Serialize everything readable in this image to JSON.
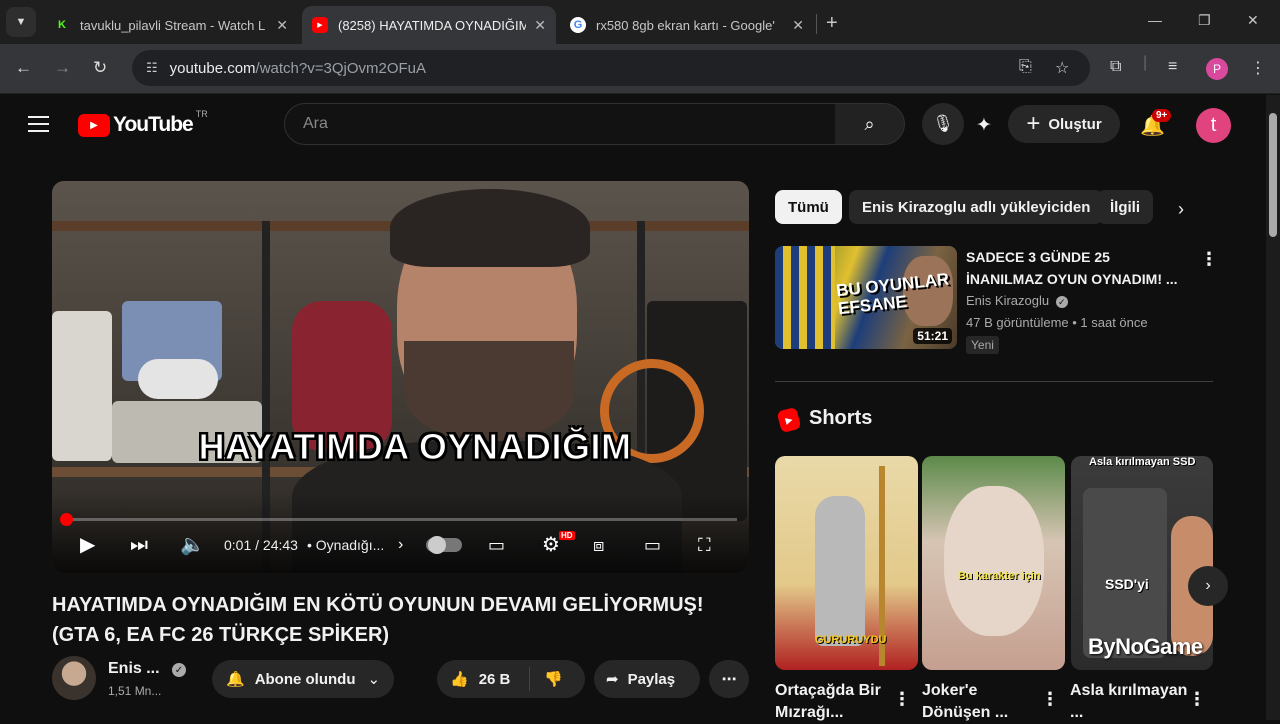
{
  "browser": {
    "tabs": [
      {
        "title": "tavuklu_pilavli Stream - Watch L",
        "favicon": "K",
        "favicon_color": "#53fc18",
        "active": false
      },
      {
        "title": "(8258) HAYATIMDA OYNADIĞIM",
        "favicon": "▶",
        "favicon_color": "#ff0000",
        "active": true
      },
      {
        "title": "rx580 8gb ekran kartı - Google'",
        "favicon": "G",
        "favicon_color": "#4285f4",
        "active": false
      }
    ],
    "url_host": "youtube.com",
    "url_path": "/watch?v=3QjOvm2OFuA",
    "profile_initial": "P"
  },
  "youtube": {
    "logo_text": "YouTube",
    "country_code": "TR",
    "search_placeholder": "Ara",
    "create_label": "Oluştur",
    "notification_count": "9+",
    "user_initial": "t"
  },
  "player": {
    "caption": "HAYATIMDA OYNADIĞIM",
    "time_current": "0:01",
    "time_total": "24:43",
    "chapter": "• Oynadığı...",
    "progress_fraction": 0.0007,
    "hd_badge": "HD"
  },
  "video": {
    "title": "HAYATIMDA OYNADIĞIM EN KÖTÜ OYUNUN DEVAMI GELİYORMUŞ! (GTA 6, EA FC 26 TÜRKÇE SPİKER)",
    "channel_name": "Enis ...",
    "subscribers": "1,51 Mn...",
    "subscribe_label": "Abone olundu",
    "likes": "26 B",
    "share_label": "Paylaş"
  },
  "sidebar": {
    "chips": [
      "Tümü",
      "Enis Kirazoglu adlı yükleyiciden",
      "İlgili"
    ],
    "recommended": {
      "title": "SADECE 3 GÜNDE 25 İNANILMAZ OYUN OYNADIM! ...",
      "thumb_text": "BU OYUNLAR EFSANE",
      "duration": "51:21",
      "channel": "Enis Kirazoglu",
      "meta": "47 B görüntüleme • 1 saat önce",
      "badge": "Yeni"
    },
    "shorts_heading": "Shorts",
    "shorts": [
      {
        "title": "Ortaçağda Bir Mızrağı...",
        "overlay": "GURURUYDU"
      },
      {
        "title": "Joker'e Dönüşen ...",
        "overlay": "Bu karakter için"
      },
      {
        "title": "Asla kırılmayan ...",
        "overlay": "Asla kırılmayan SSD",
        "overlay2": "SSD'yi"
      }
    ],
    "watermark": "ByNoGame"
  }
}
